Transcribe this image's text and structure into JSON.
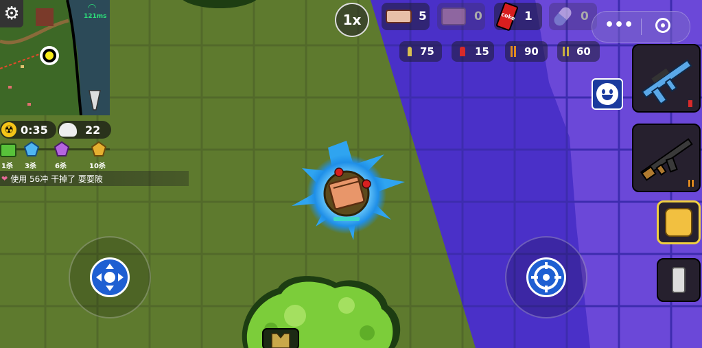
{
  "hud": {
    "zoom_label": "1x",
    "inventory": [
      {
        "name": "bandage",
        "count": "5"
      },
      {
        "name": "medkit",
        "count": "0"
      },
      {
        "name": "coke",
        "count": "1",
        "item_label": "coke"
      },
      {
        "name": "pills",
        "count": "0"
      }
    ],
    "ammo": [
      {
        "name": "ammo-yellow",
        "count": "75"
      },
      {
        "name": "ammo-red",
        "count": "15"
      },
      {
        "name": "ammo-orange",
        "count": "90"
      },
      {
        "name": "ammo-light",
        "count": "60"
      }
    ],
    "network_latency": "121ms",
    "zone_timer": "0:35",
    "players_alive": "22",
    "kill_rewards": [
      {
        "icon": "green-chest",
        "label": "1杀"
      },
      {
        "icon": "blue-gem",
        "label": "3杀"
      },
      {
        "icon": "purple-gem",
        "label": "6杀"
      },
      {
        "icon": "gold-gem",
        "label": "10杀"
      }
    ],
    "kill_feed": "使用 56冲 干掉了 耍耍陂"
  },
  "colors": {
    "grass": "#5e7a2e",
    "zone": "#4a30c8",
    "zone_outer": "#6b48d8",
    "joystick": "#1e5fd2"
  },
  "weapons": [
    {
      "name": "assault-rifle-blue",
      "selected": true
    },
    {
      "name": "ak-rifle",
      "selected": false
    }
  ]
}
